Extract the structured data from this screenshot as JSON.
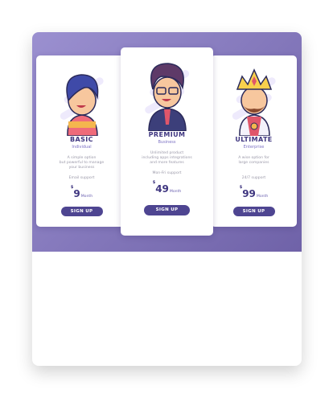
{
  "plans": [
    {
      "name": "BASIC",
      "tier": "Individual",
      "description": [
        "A simple option",
        "but powerful to manage",
        "your business"
      ],
      "feature": "Email support",
      "currency": "$",
      "price": "9",
      "period": "Month",
      "button": "SIGN UP",
      "avatar": "boy-avatar-icon"
    },
    {
      "name": "PREMIUM",
      "tier": "Business",
      "description": [
        "Unlimited product",
        "including apps integrations",
        "and more features"
      ],
      "feature": "Mon-Fri support",
      "currency": "$",
      "price": "49",
      "period": "Month",
      "button": "SIGN UP",
      "avatar": "businessman-avatar-icon"
    },
    {
      "name": "ULTIMATE",
      "tier": "Enterprise",
      "description": [
        "A wise option for",
        "large companies"
      ],
      "feature": "24/7 support",
      "currency": "$",
      "price": "99",
      "period": "Month",
      "button": "SIGN UP",
      "avatar": "king-avatar-icon"
    }
  ],
  "colors": {
    "accent": "#4e4591",
    "header_gradient_start": "#9b90d0",
    "header_gradient_end": "#6f62a8",
    "title": "#3f3680"
  }
}
